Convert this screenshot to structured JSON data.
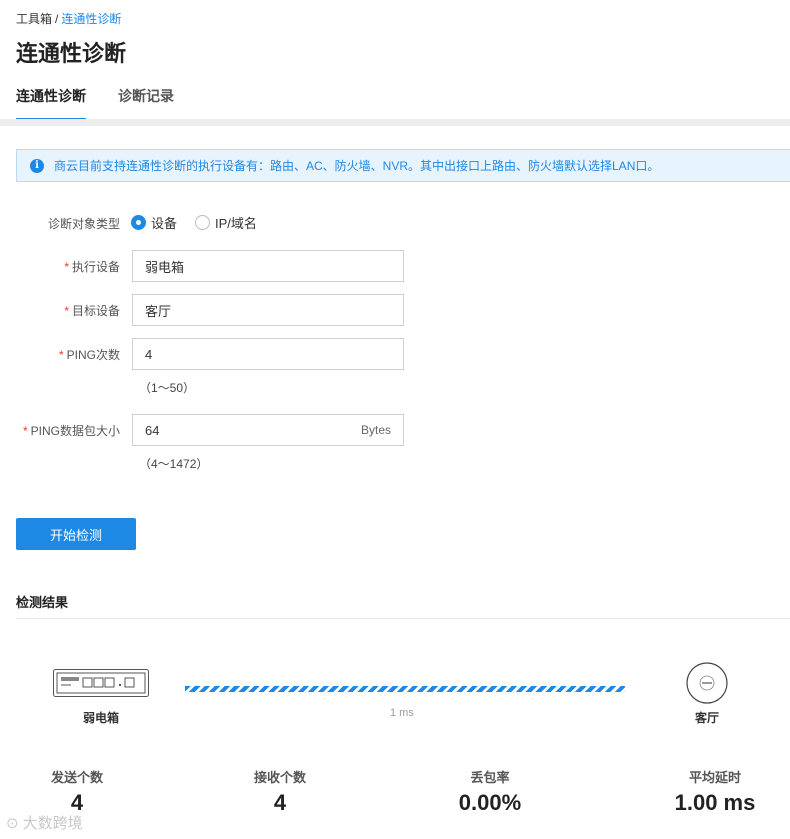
{
  "breadcrumb": {
    "parent": "工具箱",
    "separator": "/",
    "current": "连通性诊断"
  },
  "page_title": "连通性诊断",
  "tabs": [
    {
      "label": "连通性诊断",
      "active": true
    },
    {
      "label": "诊断记录",
      "active": false
    }
  ],
  "info": {
    "text": "商云目前支持连通性诊断的执行设备有：路由、AC、防火墙、NVR。其中出接口上路由、防火墙默认选择LAN口。"
  },
  "form": {
    "target_type": {
      "label": "诊断对象类型",
      "options": [
        "设备",
        "IP/域名"
      ],
      "selected": "设备"
    },
    "exec_device": {
      "label": "执行设备",
      "value": "弱电箱"
    },
    "target_device": {
      "label": "目标设备",
      "value": "客厅"
    },
    "ping_count": {
      "label": "PING次数",
      "value": "4",
      "hint": "（1～50）"
    },
    "ping_size": {
      "label": "PING数据包大小",
      "value": "64",
      "unit": "Bytes",
      "hint": "（4～1472）"
    }
  },
  "start_button": "开始检测",
  "result": {
    "title": "检测结果",
    "source_device": "弱电箱",
    "target_device": "客厅",
    "latency": "1 ms",
    "stats": [
      {
        "label": "发送个数",
        "value": "4"
      },
      {
        "label": "接收个数",
        "value": "4"
      },
      {
        "label": "丢包率",
        "value": "0.00%"
      },
      {
        "label": "平均延时",
        "value": "1.00 ms"
      }
    ]
  },
  "watermark": "大数跨境",
  "colors": {
    "accent": "#1e88e5",
    "info_bg": "#e8f4fd",
    "required": "#e53935"
  }
}
